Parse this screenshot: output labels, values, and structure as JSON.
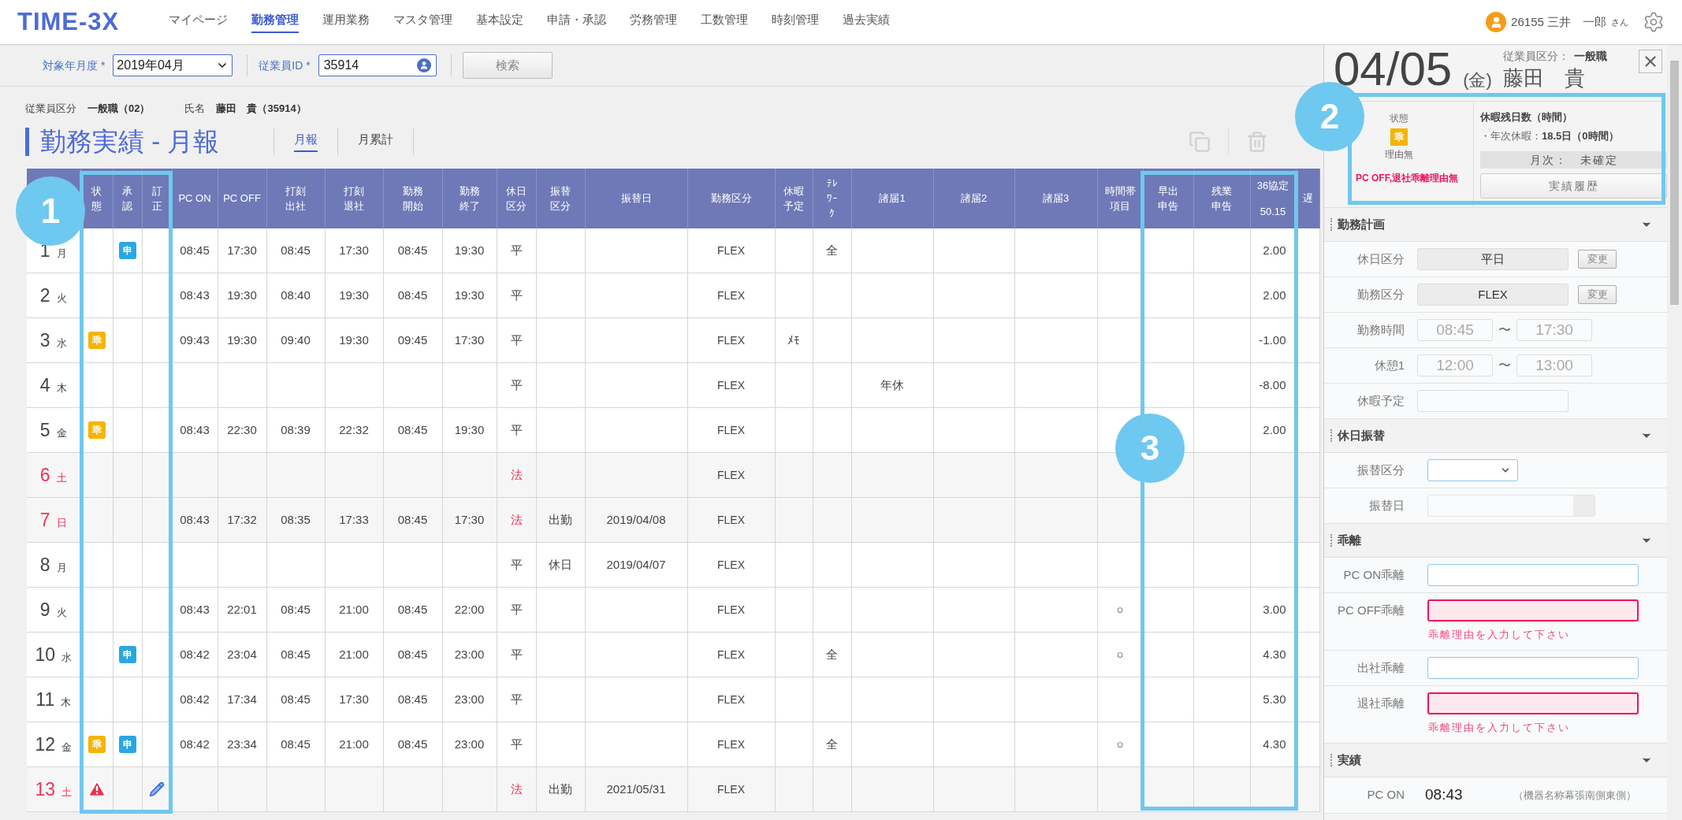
{
  "header": {
    "logo": "TIME-3X",
    "nav": [
      {
        "label": "マイページ",
        "selected": false
      },
      {
        "label": "勤務管理",
        "selected": true
      },
      {
        "label": "運用業務",
        "selected": false
      },
      {
        "label": "マスタ管理",
        "selected": false
      },
      {
        "label": "基本設定",
        "selected": false
      },
      {
        "label": "申請・承認",
        "selected": false
      },
      {
        "label": "労務管理",
        "selected": false
      },
      {
        "label": "工数管理",
        "selected": false
      },
      {
        "label": "時刻管理",
        "selected": false
      },
      {
        "label": "過去実績",
        "selected": false
      }
    ],
    "user": "26155 三井　一郎",
    "honorific": "さん"
  },
  "filters": {
    "month_label": "対象年月度 *",
    "month_value": "2019年04月",
    "employee_label": "従業員ID *",
    "employee_value": "35914",
    "search_button": "検索"
  },
  "employee_info": {
    "class_label": "従業員区分",
    "class_value": "一般職（02）",
    "name_label": "氏名",
    "name_value": "藤田　貴（35914）"
  },
  "page_title": "勤務実績 - 月報",
  "tabs": [
    {
      "label": "月報",
      "selected": true
    },
    {
      "label": "月累計",
      "selected": false
    }
  ],
  "table": {
    "columns": [
      {},
      {
        "label": "状態"
      },
      {
        "label": "承認"
      },
      {
        "label": "訂正"
      },
      {
        "label": "PC ON"
      },
      {
        "label": "PC OFF"
      },
      {
        "label": "打刻出社"
      },
      {
        "label": "打刻退社"
      },
      {
        "label": "勤務開始"
      },
      {
        "label": "勤務終了"
      },
      {
        "label": "休日区分"
      },
      {
        "label": "振替区分"
      },
      {
        "label": "振替日"
      },
      {
        "label": "勤務区分"
      },
      {
        "label": "休暇予定"
      },
      {
        "label": "ﾃﾚﾜｰｸ"
      },
      {
        "label": "諸届1"
      },
      {
        "label": "諸届2"
      },
      {
        "label": "諸届3"
      },
      {
        "label": "時間帯項目"
      },
      {
        "label": "早出申告"
      },
      {
        "label": "残業申告"
      },
      {
        "label": "36協定",
        "sub": "50.15"
      },
      {
        "label": "遅"
      }
    ],
    "rows": [
      {
        "day": "1",
        "weekday": "月",
        "holiday": false,
        "edited": false,
        "approval": "申",
        "pc_on": "08:45",
        "pc_off": "17:30",
        "stamp_in": "08:45",
        "stamp_out": "17:30",
        "work_start": "08:45",
        "work_end": "19:30",
        "holiday_type": "平",
        "work_type": "FLEX",
        "telework": "全",
        "agreement36": "2.00"
      },
      {
        "day": "2",
        "weekday": "火",
        "holiday": false,
        "edited": false,
        "pc_on": "08:43",
        "pc_off": "19:30",
        "stamp_in": "08:40",
        "stamp_out": "19:30",
        "work_start": "08:45",
        "work_end": "19:30",
        "holiday_type": "平",
        "work_type": "FLEX",
        "agreement36": "2.00"
      },
      {
        "day": "3",
        "weekday": "水",
        "holiday": false,
        "edited": false,
        "status": {
          "kind": "badge",
          "text": "乖"
        },
        "pc_on": "09:43",
        "pc_off": "19:30",
        "stamp_in": "09:40",
        "stamp_out": "19:30",
        "work_start": "09:45",
        "work_end": "17:30",
        "holiday_type": "平",
        "work_type": "FLEX",
        "leave_plan": "ﾒﾓ",
        "agreement36": "-1.00"
      },
      {
        "day": "4",
        "weekday": "木",
        "holiday": false,
        "edited": false,
        "holiday_type": "平",
        "work_type": "FLEX",
        "notice1": "年休",
        "agreement36": "-8.00"
      },
      {
        "day": "5",
        "weekday": "金",
        "holiday": false,
        "edited": false,
        "status": {
          "kind": "badge",
          "text": "乖"
        },
        "pc_on": "08:43",
        "pc_off": "22:30",
        "stamp_in": "08:39",
        "stamp_out": "22:32",
        "work_start": "08:45",
        "work_end": "19:30",
        "holiday_type": "平",
        "work_type": "FLEX",
        "agreement36": "2.00"
      },
      {
        "day": "6",
        "weekday": "土",
        "holiday": true,
        "edited": false,
        "holiday_type": "法",
        "work_type": "FLEX"
      },
      {
        "day": "7",
        "weekday": "日",
        "holiday": true,
        "edited": false,
        "pc_on": "08:43",
        "pc_off": "17:32",
        "stamp_in": "08:35",
        "stamp_out": "17:33",
        "work_start": "08:45",
        "work_end": "17:30",
        "holiday_type": "法",
        "transfer_type": "出勤",
        "transfer_date": "2019/04/08",
        "work_type": "FLEX"
      },
      {
        "day": "8",
        "weekday": "月",
        "holiday": false,
        "edited": false,
        "holiday_type": "平",
        "transfer_type": "休日",
        "transfer_date": "2019/04/07",
        "work_type": "FLEX"
      },
      {
        "day": "9",
        "weekday": "火",
        "holiday": false,
        "edited": false,
        "pc_on": "08:43",
        "pc_off": "22:01",
        "stamp_in": "08:45",
        "stamp_out": "21:00",
        "work_start": "08:45",
        "work_end": "22:00",
        "holiday_type": "平",
        "work_type": "FLEX",
        "time_item": "○",
        "agreement36": "3.00"
      },
      {
        "day": "10",
        "weekday": "水",
        "holiday": false,
        "edited": false,
        "approval": "申",
        "pc_on": "08:42",
        "pc_off": "23:04",
        "stamp_in": "08:45",
        "stamp_out": "21:00",
        "work_start": "08:45",
        "work_end": "23:00",
        "holiday_type": "平",
        "work_type": "FLEX",
        "telework": "全",
        "time_item": "○",
        "agreement36": "4.30"
      },
      {
        "day": "11",
        "weekday": "木",
        "holiday": false,
        "edited": false,
        "pc_on": "08:42",
        "pc_off": "17:34",
        "stamp_in": "08:45",
        "stamp_out": "17:30",
        "work_start": "08:45",
        "work_end": "23:00",
        "holiday_type": "平",
        "work_type": "FLEX",
        "agreement36": "5.30"
      },
      {
        "day": "12",
        "weekday": "金",
        "holiday": false,
        "edited": false,
        "status": {
          "kind": "badge",
          "text": "乖"
        },
        "approval": "申",
        "pc_on": "08:42",
        "pc_off": "23:34",
        "stamp_in": "08:45",
        "stamp_out": "21:00",
        "work_start": "08:45",
        "work_end": "23:00",
        "holiday_type": "平",
        "work_type": "FLEX",
        "telework": "全",
        "time_item": "○",
        "agreement36": "4.30"
      },
      {
        "day": "13",
        "weekday": "土",
        "holiday": true,
        "edited": true,
        "status": {
          "kind": "alert"
        },
        "holiday_type": "法",
        "transfer_type": "出勤",
        "transfer_date": "2021/05/31",
        "work_type": "FLEX"
      }
    ]
  },
  "detail": {
    "date": "04/05",
    "weekday": "(金)",
    "class_label": "従業員区分：",
    "class_value": "一般職",
    "name": "藤田　貴",
    "status_label": "状態",
    "status_badge": "乖",
    "status_text": "理由無",
    "error": "PC OFF,退社乖離理由無",
    "leave_title": "休暇残日数（時間）",
    "leave_label": "・年次休暇：",
    "leave_value": "18.5日（0時間）",
    "monthly": "月次：　未確定",
    "history_button": "実績履歴",
    "sections": [
      {
        "title": "勤務計画",
        "expanded": true,
        "fields": [
          {
            "kind": "readonly",
            "label": "休日区分",
            "value": "平日",
            "button": "変更"
          },
          {
            "kind": "readonly",
            "label": "勤務区分",
            "value": "FLEX",
            "button": "変更"
          },
          {
            "kind": "range",
            "label": "勤務時間",
            "from": "08:45",
            "to": "17:30",
            "separator": "〜"
          },
          {
            "kind": "range",
            "label": "休憩1",
            "from": "12:00",
            "to": "13:00",
            "separator": "〜"
          },
          {
            "kind": "short",
            "label": "休暇予定"
          }
        ]
      },
      {
        "title": "休日振替",
        "expanded": true,
        "fields": [
          {
            "kind": "select",
            "label": "振替区分"
          },
          {
            "kind": "date",
            "label": "振替日"
          }
        ]
      },
      {
        "title": "乖離",
        "expanded": true,
        "fields": [
          {
            "kind": "input",
            "label": "PC ON乖離",
            "error": false
          },
          {
            "kind": "input",
            "label": "PC OFF乖離",
            "error": true,
            "message": "乖離理由を入力して下さい"
          },
          {
            "kind": "input",
            "label": "出社乖離",
            "error": false
          },
          {
            "kind": "input",
            "label": "退社乖離",
            "error": true,
            "message": "乖離理由を入力して下さい"
          }
        ]
      },
      {
        "title": "実績",
        "expanded": true,
        "fields": [
          {
            "kind": "actual",
            "label": "PC ON",
            "value": "08:43",
            "note": "（機器名称幕張南側東側）"
          }
        ]
      }
    ]
  },
  "annotations": [
    {
      "number": "1"
    },
    {
      "number": "2"
    },
    {
      "number": "3"
    }
  ]
}
